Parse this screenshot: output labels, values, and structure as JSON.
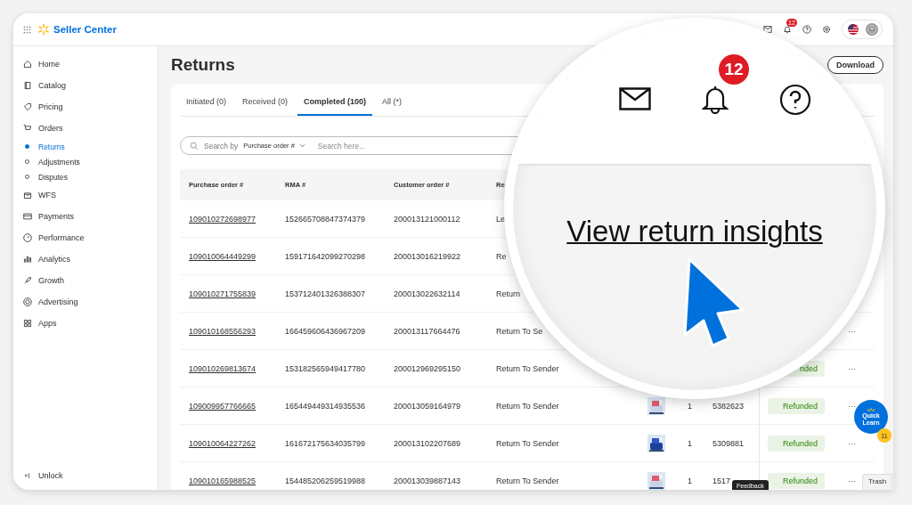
{
  "header": {
    "brand": "Seller Center",
    "notification_count": "12"
  },
  "sidebar": {
    "items": [
      {
        "label": "Home",
        "selected": false
      },
      {
        "label": "Catalog",
        "selected": false
      },
      {
        "label": "Pricing",
        "selected": false
      },
      {
        "label": "Orders",
        "selected": false,
        "children": [
          {
            "label": "Returns",
            "selected": true
          },
          {
            "label": "Adjustments",
            "selected": false
          },
          {
            "label": "Disputes",
            "selected": false
          }
        ]
      },
      {
        "label": "WFS",
        "selected": false
      },
      {
        "label": "Payments",
        "selected": false
      },
      {
        "label": "Performance",
        "selected": false
      },
      {
        "label": "Analytics",
        "selected": false
      },
      {
        "label": "Growth",
        "selected": false
      },
      {
        "label": "Advertising",
        "selected": false
      },
      {
        "label": "Apps",
        "selected": false
      }
    ],
    "footer": "Unlock"
  },
  "page": {
    "title": "Returns",
    "download": "Download"
  },
  "tabs": [
    {
      "label": "Initiated (0)",
      "selected": false
    },
    {
      "label": "Received (0)",
      "selected": false
    },
    {
      "label": "Completed (100)",
      "selected": true
    },
    {
      "label": "All (*)",
      "selected": false
    }
  ],
  "search": {
    "label": "Search by",
    "field": "Purchase order #",
    "placeholder": "Search here..."
  },
  "table": {
    "columns": [
      "Purchase order #",
      "RMA #",
      "Customer order #",
      "Re"
    ],
    "rows": [
      {
        "purchase_order": "109010272698977",
        "rma": "152665708847374379",
        "customer_order": "200013121000112",
        "reason": "Le"
      },
      {
        "purchase_order": "109010064449299",
        "rma": "159171642099270298",
        "customer_order": "200013016219922",
        "reason": "Re"
      },
      {
        "purchase_order": "109010271755839",
        "rma": "153712401326388307",
        "customer_order": "200013022632114",
        "reason": "Return"
      },
      {
        "purchase_order": "109010168556293",
        "rma": "166459606436967209",
        "customer_order": "200013117664476",
        "reason": "Return To Se",
        "actions": "···"
      },
      {
        "purchase_order": "109010269813674",
        "rma": "153182565949417780",
        "customer_order": "200012969295150",
        "reason": "Return To Sender",
        "status": "nded",
        "actions": "···"
      },
      {
        "purchase_order": "109009957766665",
        "rma": "165449449314935536",
        "customer_order": "200013059164979",
        "reason": "Return To Sender",
        "quantity": "1",
        "number": "5382623",
        "status": "Refunded",
        "actions": "···"
      },
      {
        "purchase_order": "109010064227262",
        "rma": "161672175634035799",
        "customer_order": "200013102207689",
        "reason": "Return To Sender",
        "quantity": "1",
        "number": "5309881",
        "status": "Refunded",
        "actions": "···"
      },
      {
        "purchase_order": "109010165988525",
        "rma": "154485206259519988",
        "customer_order": "200013039887143",
        "reason": "Return To Sender",
        "quantity": "1",
        "number": "1517",
        "status": "Refunded",
        "actions": "···"
      }
    ]
  },
  "magnifier": {
    "notification_count": "12",
    "link": "View return insights"
  },
  "quick_learn": {
    "label": "Quick Learn",
    "count": "11"
  },
  "feedback": "Feedback",
  "trash": "Trash"
}
